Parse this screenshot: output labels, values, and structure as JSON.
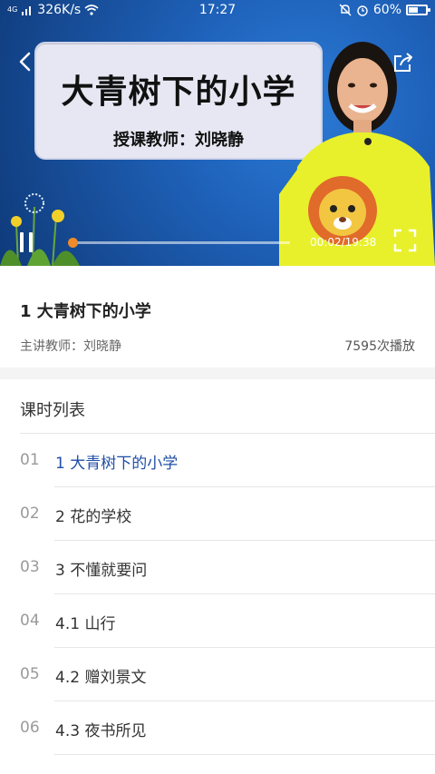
{
  "status_bar": {
    "net_badge": "4G",
    "net_speed": "326K/s",
    "time": "17:27",
    "battery": "60%",
    "battery_level": 0.6
  },
  "video": {
    "card_title": "大青树下的小学",
    "card_subtitle": "授课教师：刘晓静",
    "time_display": "00:02/19:38",
    "progress_fraction": 0.0017,
    "accent": "#f08a2a"
  },
  "lesson": {
    "title": "1 大青树下的小学",
    "teacher": "主讲教师：刘晓静",
    "plays": "7595次播放"
  },
  "lesson_list": {
    "header": "课时列表",
    "active_color": "#1f4fa6",
    "items": [
      {
        "num": "01",
        "label": "1 大青树下的小学"
      },
      {
        "num": "02",
        "label": "2 花的学校"
      },
      {
        "num": "03",
        "label": "3 不懂就要问"
      },
      {
        "num": "04",
        "label": "4.1 山行"
      },
      {
        "num": "05",
        "label": "4.2 赠刘景文"
      },
      {
        "num": "06",
        "label": "4.3 夜书所见"
      }
    ]
  }
}
